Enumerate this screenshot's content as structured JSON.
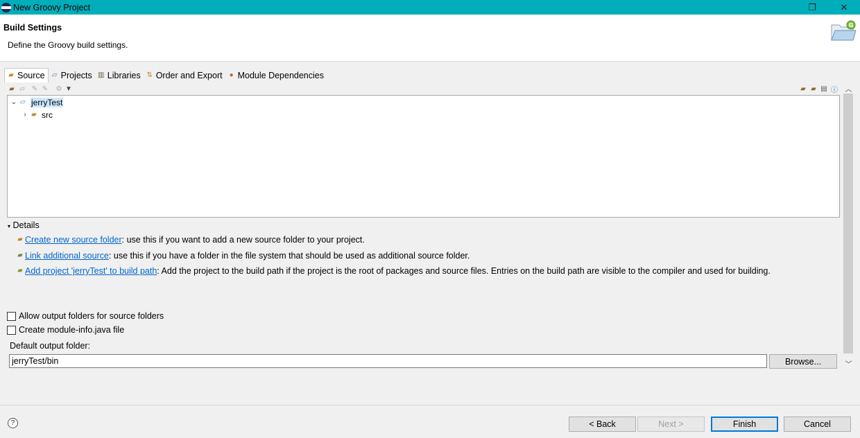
{
  "window": {
    "title": "New Groovy Project",
    "minimize_glyph": "—",
    "maximize_glyph": "❐",
    "close_glyph": "✕"
  },
  "header": {
    "title": "Build Settings",
    "description": "Define the Groovy build settings.",
    "icon": "groovy-folder-icon"
  },
  "tabs": [
    {
      "label": "Source",
      "icon": "source-folder-icon",
      "active": true
    },
    {
      "label": "Projects",
      "icon": "projects-icon",
      "active": false
    },
    {
      "label": "Libraries",
      "icon": "libraries-icon",
      "active": false
    },
    {
      "label": "Order and Export",
      "icon": "order-export-icon",
      "active": false
    },
    {
      "label": "Module Dependencies",
      "icon": "module-dependencies-icon",
      "active": false
    }
  ],
  "tree": {
    "root": {
      "label": "jerryTest",
      "expanded": true,
      "selected": true
    },
    "children": [
      {
        "label": "src",
        "expanded": false
      }
    ]
  },
  "details": {
    "heading": "Details",
    "items": [
      {
        "link": "Create new source folder",
        "text": ": use this if you want to add a new source folder to your project."
      },
      {
        "link": "Link additional source",
        "text": ": use this if you have a folder in the file system that should be used as additional source folder."
      },
      {
        "link": "Add project 'jerryTest' to build path",
        "text": ": Add the project to the build path if the project is the root of packages and source files. Entries on the build path are visible to the compiler and used for building."
      }
    ]
  },
  "options": {
    "allow_output_folders": {
      "label": "Allow output folders for source folders",
      "checked": false
    },
    "create_module_info": {
      "label": "Create module-info.java file",
      "checked": false
    }
  },
  "output": {
    "label": "Default output folder:",
    "value": "jerryTest/bin",
    "browse_label": "Browse..."
  },
  "footer": {
    "help_glyph": "?",
    "back_label": "< Back",
    "next_label": "Next >",
    "finish_label": "Finish",
    "cancel_label": "Cancel"
  },
  "colors": {
    "titlebar": "#00aebb",
    "link": "#0066cc",
    "selection": "#cce8ff",
    "default_button_border": "#0078d7"
  }
}
